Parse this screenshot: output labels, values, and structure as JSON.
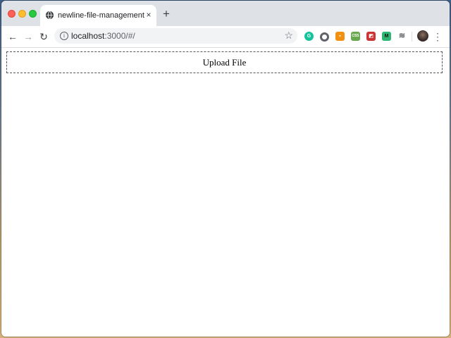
{
  "browser": {
    "tab": {
      "title": "newline-file-management",
      "close_glyph": "×"
    },
    "new_tab_glyph": "+",
    "nav": {
      "back_glyph": "←",
      "forward_glyph": "→",
      "reload_glyph": "↻"
    },
    "address": {
      "host": "localhost",
      "rest": ":3000/#/",
      "info_glyph": "i",
      "bookmark_glyph": "☆"
    },
    "extensions": [
      {
        "name": "grammarly-icon",
        "glyph": "G"
      },
      {
        "name": "circle-extension-icon",
        "glyph": ""
      },
      {
        "name": "orange-extension-icon",
        "glyph": "▪"
      },
      {
        "name": "green-extension-icon",
        "glyph": "CSS"
      },
      {
        "name": "red-extension-icon",
        "glyph": "◩"
      },
      {
        "name": "m-extension-icon",
        "glyph": "M"
      },
      {
        "name": "database-extension-icon",
        "glyph": "≋"
      }
    ],
    "menu_glyph": "⋮"
  },
  "page": {
    "upload_label": "Upload File"
  },
  "colors": {
    "tabstrip": "#dee1e6",
    "omnibox": "#f1f3f4",
    "upload_border": "#555555"
  }
}
